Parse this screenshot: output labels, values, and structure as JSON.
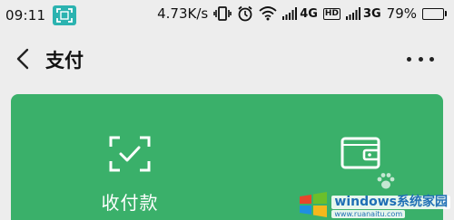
{
  "status_bar": {
    "time": "09:11",
    "net_speed": "4.73K/s",
    "network_1": "4G",
    "hd_label": "HD",
    "network_2": "3G",
    "battery": "79%",
    "battery_level": 0.79,
    "icons": [
      "scan-icon",
      "vibrate-icon",
      "alarm-icon",
      "wifi-icon",
      "signal-icon",
      "signal-icon",
      "battery-icon"
    ]
  },
  "nav": {
    "title": "支付",
    "back_icon": "chevron-left-icon",
    "more_icon": "more-icon"
  },
  "pay_card": {
    "color": "#3ab06a",
    "items": [
      {
        "label": "收付款",
        "icon": "scan-check-icon"
      },
      {
        "label": "",
        "icon": "wallet-icon"
      }
    ]
  },
  "watermark": {
    "main": "windows系统家园",
    "sub": "www.ruanaitu.com"
  }
}
